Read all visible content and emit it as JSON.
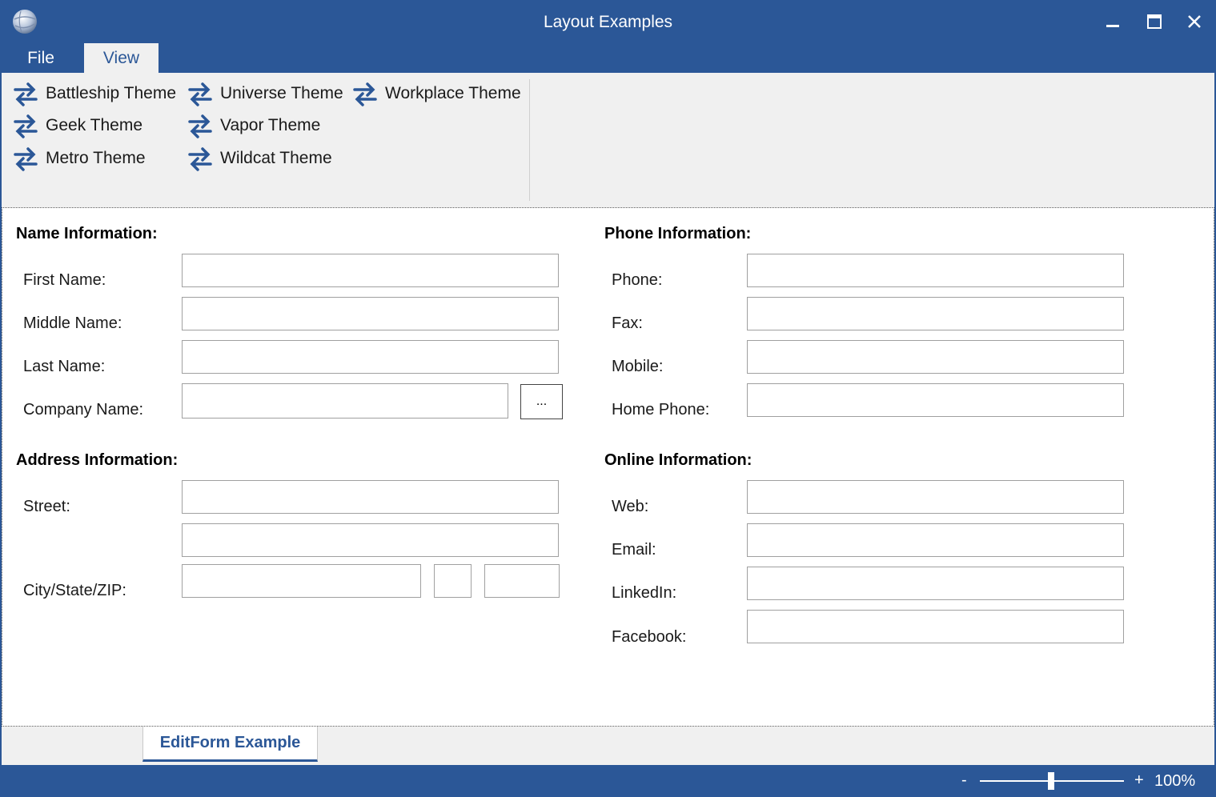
{
  "window": {
    "title": "Layout Examples",
    "app_icon": "globe-icon",
    "controls": [
      "minimize-icon",
      "maximize-icon",
      "close-icon"
    ]
  },
  "ribbon": {
    "tabs": [
      {
        "label": "File",
        "selected": false
      },
      {
        "label": "View",
        "selected": true
      }
    ],
    "theme_icon": "swap-arrows-icon",
    "themes": [
      "Battleship Theme",
      "Geek Theme",
      "Metro Theme",
      "Universe Theme",
      "Vapor Theme",
      "Wildcat Theme",
      "Workplace Theme"
    ]
  },
  "form": {
    "name_section": {
      "title": "Name Information:",
      "first_name": {
        "label": "First Name:",
        "value": ""
      },
      "middle_name": {
        "label": "Middle Name:",
        "value": ""
      },
      "last_name": {
        "label": "Last Name:",
        "value": ""
      },
      "company_name": {
        "label": "Company Name:",
        "value": ""
      },
      "browse_button": "..."
    },
    "phone_section": {
      "title": "Phone Information:",
      "phone": {
        "label": "Phone:",
        "value": ""
      },
      "fax": {
        "label": "Fax:",
        "value": ""
      },
      "mobile": {
        "label": "Mobile:",
        "value": ""
      },
      "home_phone": {
        "label": "Home Phone:",
        "value": ""
      }
    },
    "address_section": {
      "title": "Address Information:",
      "street": {
        "label": "Street:",
        "value_line1": "",
        "value_line2": ""
      },
      "city_state_zip": {
        "label": "City/State/ZIP:",
        "city": "",
        "state": "",
        "zip": ""
      }
    },
    "online_section": {
      "title": "Online Information:",
      "web": {
        "label": "Web:",
        "value": ""
      },
      "email": {
        "label": "Email:",
        "value": ""
      },
      "linkedin": {
        "label": "LinkedIn:",
        "value": ""
      },
      "facebook": {
        "label": "Facebook:",
        "value": ""
      }
    }
  },
  "document_tabs": [
    {
      "label": "EditForm Example",
      "selected": true
    }
  ],
  "statusbar": {
    "zoom_minus": "-",
    "zoom_plus": "+",
    "zoom_level": "100%",
    "zoom_percent": 100
  },
  "colors": {
    "accent": "#2b5797",
    "ribbon_bg": "#f0f0f0",
    "content_bg": "#ffffff"
  }
}
